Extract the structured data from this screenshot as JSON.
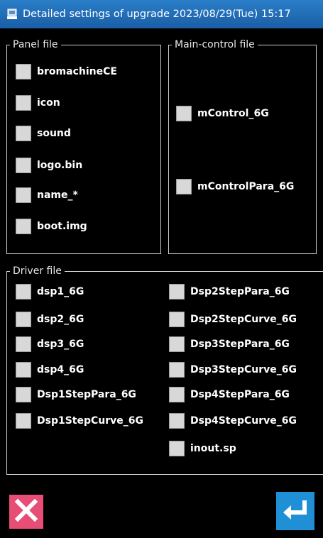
{
  "titlebar": {
    "icon": "device-icon",
    "title": "Detailed settings of upgrade 2023/08/29(Tue) 15:17"
  },
  "panel_file": {
    "legend": "Panel file",
    "items": [
      {
        "label": "bromachineCE"
      },
      {
        "label": "icon"
      },
      {
        "label": "sound"
      },
      {
        "label": "logo.bin"
      },
      {
        "label": "name_*"
      },
      {
        "label": "boot.img"
      }
    ]
  },
  "main_control_file": {
    "legend": "Main-control file",
    "items": [
      {
        "label": "mControl_6G"
      },
      {
        "label": "mControlPara_6G"
      }
    ]
  },
  "driver_file": {
    "legend": "Driver file",
    "left": [
      {
        "label": "dsp1_6G"
      },
      {
        "label": "dsp2_6G"
      },
      {
        "label": "dsp3_6G"
      },
      {
        "label": "dsp4_6G"
      },
      {
        "label": "Dsp1StepPara_6G"
      },
      {
        "label": "Dsp1StepCurve_6G"
      }
    ],
    "right": [
      {
        "label": "Dsp2StepPara_6G"
      },
      {
        "label": "Dsp2StepCurve_6G"
      },
      {
        "label": "Dsp3StepPara_6G"
      },
      {
        "label": "Dsp3StepCurve_6G"
      },
      {
        "label": "Dsp4StepPara_6G"
      },
      {
        "label": "Dsp4StepCurve_6G"
      },
      {
        "label": "inout.sp"
      }
    ]
  },
  "buttons": {
    "cancel_icon": "close-icon",
    "ok_icon": "enter-icon"
  },
  "colors": {
    "titlebar": "#1a5ea6",
    "cancel": "#e64e76",
    "ok": "#1f8fd6",
    "checkbox": "#d8d8d8"
  }
}
